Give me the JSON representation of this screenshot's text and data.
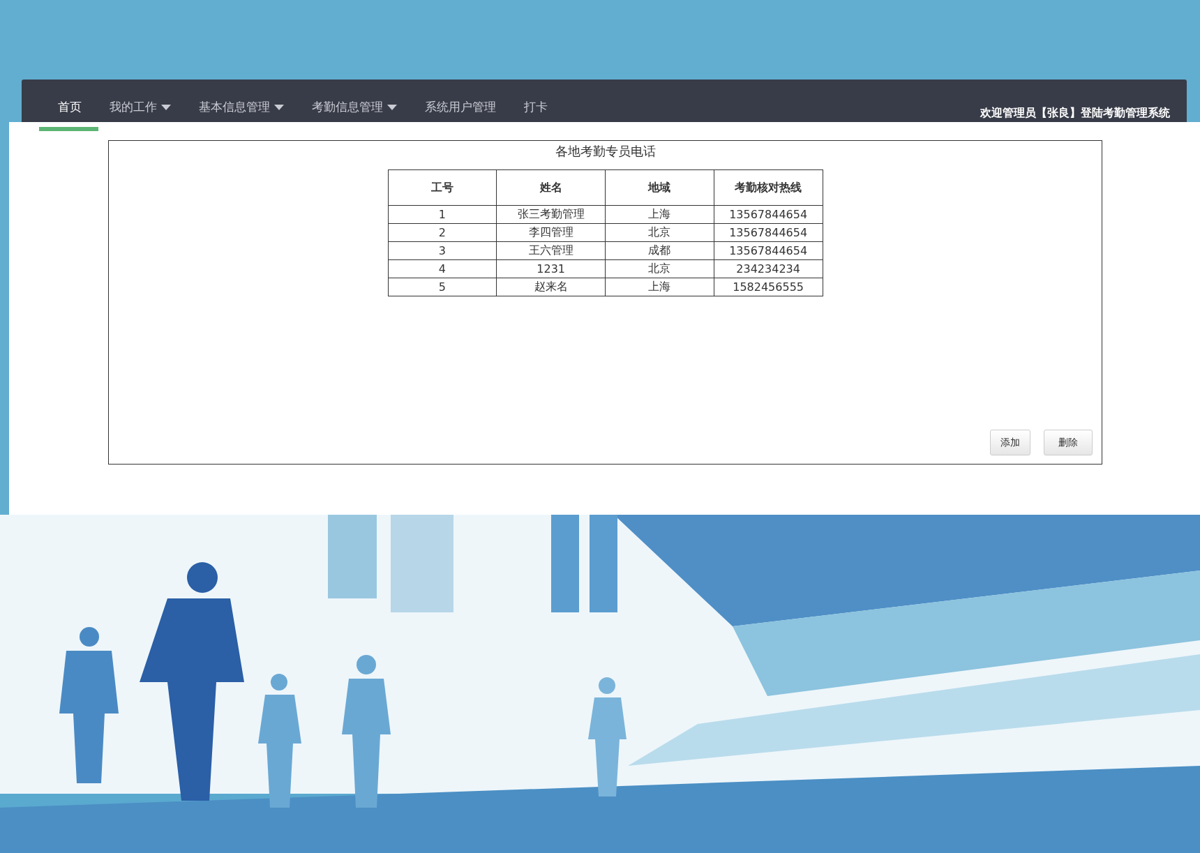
{
  "nav": {
    "items": [
      {
        "label": "首页",
        "has_menu": false,
        "selected": true
      },
      {
        "label": "我的工作",
        "has_menu": true,
        "selected": false
      },
      {
        "label": "基本信息管理",
        "has_menu": true,
        "selected": false
      },
      {
        "label": "考勤信息管理",
        "has_menu": true,
        "selected": false
      },
      {
        "label": "系统用户管理",
        "has_menu": false,
        "selected": false
      },
      {
        "label": "打卡",
        "has_menu": false,
        "selected": false
      }
    ],
    "welcome": "欢迎管理员【张良】登陆考勤管理系统"
  },
  "panel": {
    "title": "各地考勤专员电话",
    "table": {
      "columns": [
        "工号",
        "姓名",
        "地域",
        "考勤核对热线"
      ],
      "rows": [
        [
          "1",
          "张三考勤管理",
          "上海",
          "13567844654"
        ],
        [
          "2",
          "李四管理",
          "北京",
          "13567844654"
        ],
        [
          "3",
          "王六管理",
          "成都",
          "13567844654"
        ],
        [
          "4",
          "1231",
          "北京",
          "234234234"
        ],
        [
          "5",
          "赵来名",
          "上海",
          "1582456555"
        ]
      ]
    },
    "buttons": [
      "添加",
      "删除"
    ]
  }
}
